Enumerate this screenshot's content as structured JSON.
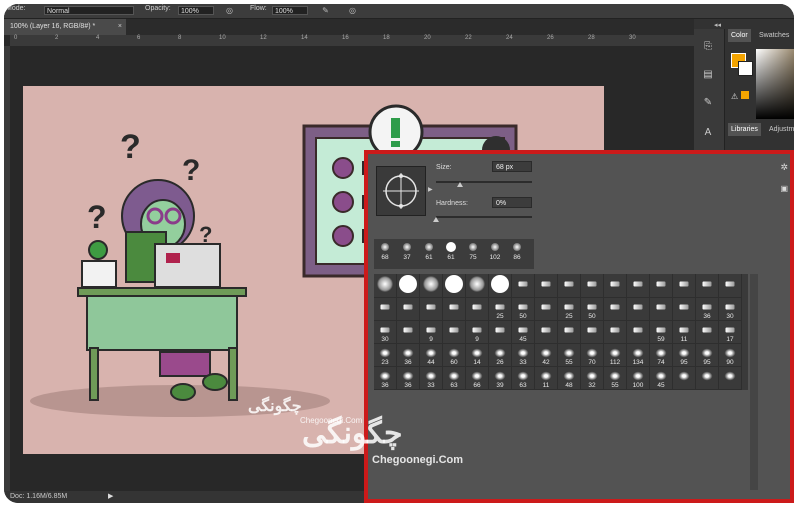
{
  "options_bar": {
    "mode_label": "Mode:",
    "mode_value": "Normal",
    "opacity_label": "Opacity:",
    "opacity_value": "100%",
    "flow_label": "Flow:",
    "flow_value": "100%"
  },
  "document_tab": {
    "title": "100% (Layer 16, RGB/8#) *",
    "close": "×"
  },
  "ruler_ticks": [
    "0",
    "2",
    "4",
    "6",
    "8",
    "10",
    "12",
    "14",
    "16",
    "18",
    "20",
    "22",
    "24",
    "26",
    "28",
    "30"
  ],
  "status": {
    "doc_info": "Doc: 1.16M/6.85M"
  },
  "right_panel": {
    "tabs": [
      "Color",
      "Swatches"
    ],
    "lower_tabs": [
      "Libraries",
      "Adjustm"
    ],
    "foreground_color": "#f4a400",
    "background_color": "#ffffff",
    "collapse_icon": "double-chevron-icon"
  },
  "brush_picker": {
    "size_label": "Size:",
    "size_value": "68 px",
    "hardness_label": "Hardness:",
    "hardness_value": "0%",
    "size_fraction": 0.25,
    "hardness_fraction": 0.0,
    "border_color": "#cc1a1a",
    "presets": [
      "68",
      "37",
      "61",
      "61",
      "75",
      "102",
      "86"
    ],
    "grid_rows": [
      [
        "",
        "",
        "",
        "",
        "",
        "",
        "",
        "",
        "",
        "",
        "",
        "",
        "",
        "",
        "",
        ""
      ],
      [
        "",
        "",
        "",
        "",
        "",
        "25",
        "50",
        "",
        "25",
        "50",
        "",
        "",
        "",
        "",
        "36",
        "30"
      ],
      [
        "30",
        "",
        "9",
        "",
        "9",
        "",
        "45",
        "",
        "",
        "",
        "",
        "",
        "59",
        "11",
        "",
        "17"
      ],
      [
        "23",
        "36",
        "44",
        "60",
        "14",
        "26",
        "33",
        "42",
        "55",
        "70",
        "112",
        "134",
        "74",
        "95",
        "95",
        "90"
      ],
      [
        "36",
        "36",
        "33",
        "63",
        "66",
        "39",
        "63",
        "11",
        "48",
        "32",
        "55",
        "100",
        "45",
        "",
        "",
        ""
      ]
    ]
  },
  "watermark": {
    "brand": "چگونگی",
    "url_small": "Chegoonegi.Com",
    "url_large": "Chegoonegi.Com"
  }
}
